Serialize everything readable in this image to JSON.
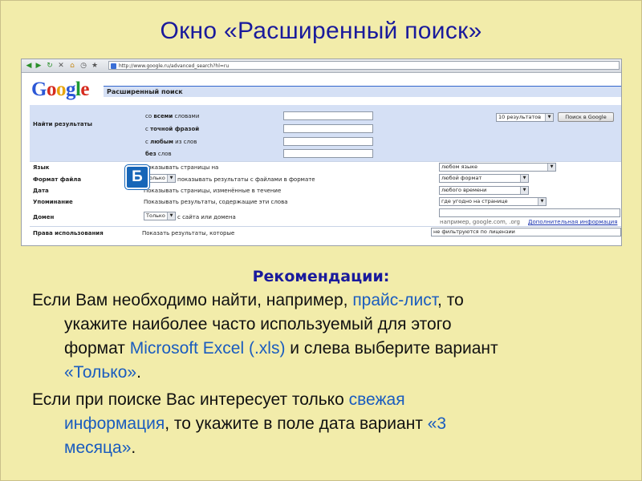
{
  "slide": {
    "title": "Окно «Расширенный поиск»"
  },
  "browser": {
    "url": "http://www.google.ru/advanced_search?hl=ru"
  },
  "google": {
    "logo_letters": [
      "G",
      "o",
      "o",
      "g",
      "l",
      "e"
    ],
    "page_title": "Расширенный поиск",
    "find_results_label": "Найти результаты",
    "rows": [
      {
        "pre": "со ",
        "bold": "всеми",
        "post": " словами"
      },
      {
        "pre": "с ",
        "bold": "точной фразой",
        "post": ""
      },
      {
        "pre": "с ",
        "bold": "любым",
        "post": " из слов"
      },
      {
        "pre": "",
        "bold": "без",
        "post": " слов"
      }
    ],
    "results_select": "10 результатов",
    "search_button": "Поиск в Google",
    "language_label": "Язык",
    "language_desc": "Показывать страницы на",
    "language_value": "любом языке",
    "format_label": "Формат файла",
    "format_only": "Только",
    "format_desc": "показывать результаты с файлами в формате",
    "format_value": "любой формат",
    "date_label": "Дата",
    "date_desc": "Показывать страницы, изменённые в течение",
    "date_value": "любого времени",
    "mention_label": "Упоминание",
    "mention_desc": "Показывать результаты, содержащие эти слова",
    "mention_value": "где угодно на странице",
    "domain_label": "Домен",
    "domain_only": "Только",
    "domain_desc": "с сайта или домена",
    "domain_hint": "например, google.com, .org",
    "domain_more": "Дополнительная информация",
    "rights_label": "Права использования",
    "rights_desc": "Показать результаты, которые",
    "rights_value": "не фильтруются по лицензии"
  },
  "badge": {
    "letter": "Б"
  },
  "recommendations": {
    "heading": "Рекомендации:",
    "p1": {
      "l1_a": "Если Вам необходимо найти, например, ",
      "l1_hl": "прайс-лист",
      "l1_b": ", то",
      "l2": "укажите наиболее часто используемый для этого",
      "l3_a": "формат ",
      "l3_hl": "Microsoft Excel (.xls)",
      "l3_b": " и слева выберите вариант",
      "l4_hl": "«Только»",
      "l4_b": "."
    },
    "p2": {
      "l1_a": "Если при поиске Вас интересует только ",
      "l1_hl": "свежая",
      "l2_hl": "информация",
      "l2_b": ", то укажите в поле дата вариант ",
      "l2_hl2": "«3",
      "l3_hl": "месяца»",
      "l3_b": "."
    }
  },
  "colors": {
    "slide_bg": "#f2ecaa",
    "title_blue": "#1a1a9c",
    "highlight_blue": "#1a5cbf",
    "panel_blue": "#d5e0f5",
    "badge_blue": "#1766b8"
  }
}
